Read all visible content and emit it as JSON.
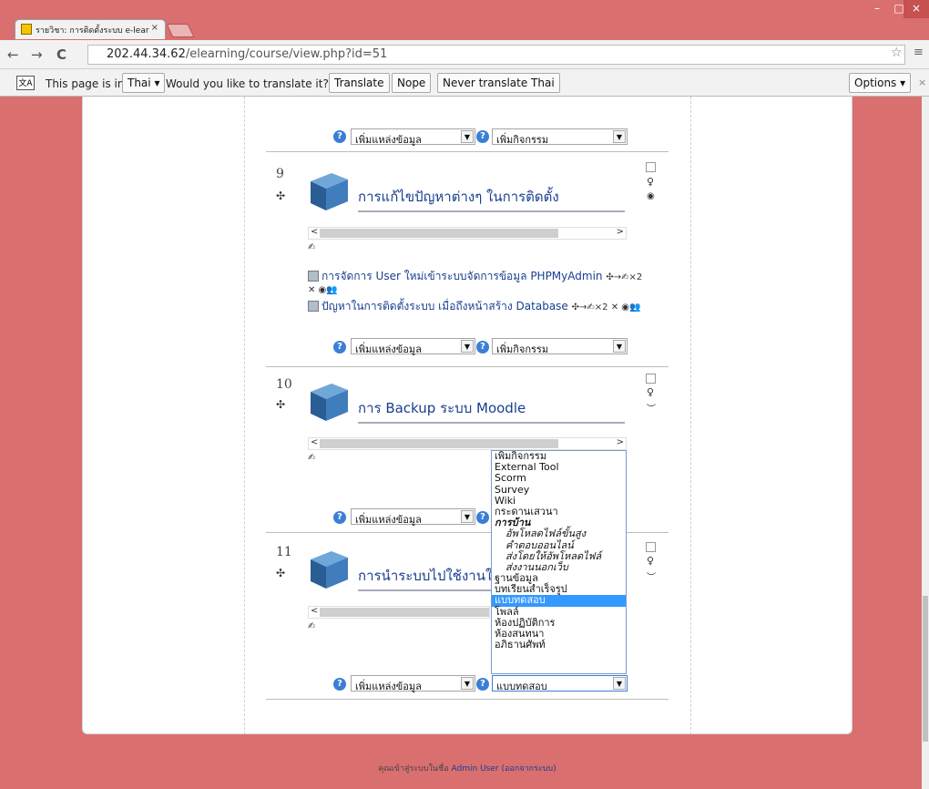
{
  "browser": {
    "tab_title": "รายวิชา: การติดตั้งระบบ e-lear",
    "tab_close": "×",
    "url_host": "202.44.34.62",
    "url_path": "/elearning/course/view.php?id=51",
    "back": "←",
    "forward": "→",
    "reload": "C",
    "star": "☆",
    "menu": "≡",
    "win_min": "–",
    "win_max": "□",
    "win_close": "×"
  },
  "translate": {
    "icon": "文A",
    "text1": "This page is in",
    "lang": "Thai ▾",
    "text2": "Would you like to translate it?",
    "translate_btn": "Translate",
    "nope_btn": "Nope",
    "never_btn": "Never translate Thai",
    "options_btn": "Options ▾",
    "close": "×"
  },
  "controls": {
    "help": "?",
    "add_resource": "เพิ่มแหล่งข้อมูล",
    "add_activity": "เพิ่มกิจกรรม",
    "selected_activity": "แบบทดสอบ",
    "move": "✣",
    "pencil": "✍",
    "bulb": "♀",
    "eye_open": "◉",
    "eye_closed": "︶",
    "scroll_left": "<",
    "scroll_right": ">"
  },
  "sections": [
    {
      "num": "9",
      "title": "การแก้ไขปัญหาต่างๆ ในการติดตั้ง"
    },
    {
      "num": "10",
      "title": "การ Backup ระบบ Moodle"
    },
    {
      "num": "11",
      "title": "การนำระบบไปใช้งานใน"
    }
  ],
  "resources": [
    {
      "title": "การจัดการ User ใหม่เข้าระบบจัดการข้อมูล PHPMyAdmin",
      "controls": "✣→✍×2",
      "controls2": "✕ ◉👥"
    },
    {
      "title": "ปัญหาในการติดตั้งระบบ เมื่อถึงหน้าสร้าง Database",
      "controls": "✣→✍×2 ✕ ◉👥"
    }
  ],
  "dropdown": [
    {
      "label": "เพิ่มกิจกรรม",
      "kind": "normal"
    },
    {
      "label": "External Tool",
      "kind": "normal"
    },
    {
      "label": "Scorm",
      "kind": "normal"
    },
    {
      "label": "Survey",
      "kind": "normal"
    },
    {
      "label": "Wiki",
      "kind": "normal"
    },
    {
      "label": "กระดานเสวนา",
      "kind": "normal"
    },
    {
      "label": "การบ้าน",
      "kind": "grp"
    },
    {
      "label": "อัพโหลดไฟล์ขั้นสูง",
      "kind": "sub"
    },
    {
      "label": "คำตอบออนไลน์",
      "kind": "sub"
    },
    {
      "label": "ส่งโดยให้อัพโหลดไฟล์",
      "kind": "sub"
    },
    {
      "label": "ส่งงานนอกเว็บ",
      "kind": "sub"
    },
    {
      "label": "ฐานข้อมูล",
      "kind": "normal"
    },
    {
      "label": "บทเรียนสำเร็จรูป",
      "kind": "normal"
    },
    {
      "label": "แบบทดสอบ",
      "kind": "sel"
    },
    {
      "label": "โพลล์",
      "kind": "normal"
    },
    {
      "label": "ห้องปฏิบัติการ",
      "kind": "normal"
    },
    {
      "label": "ห้องสนทนา",
      "kind": "normal"
    },
    {
      "label": "อภิธานศัพท์",
      "kind": "normal"
    }
  ],
  "footer": {
    "text": "คุณเข้าสู่ระบบในชื่อ",
    "user": "Admin User",
    "logout": "(ออกจากระบบ)"
  },
  "colors": {
    "frame": "#d96f6f",
    "link": "#1a3e8f",
    "highlight": "#3399ff"
  }
}
